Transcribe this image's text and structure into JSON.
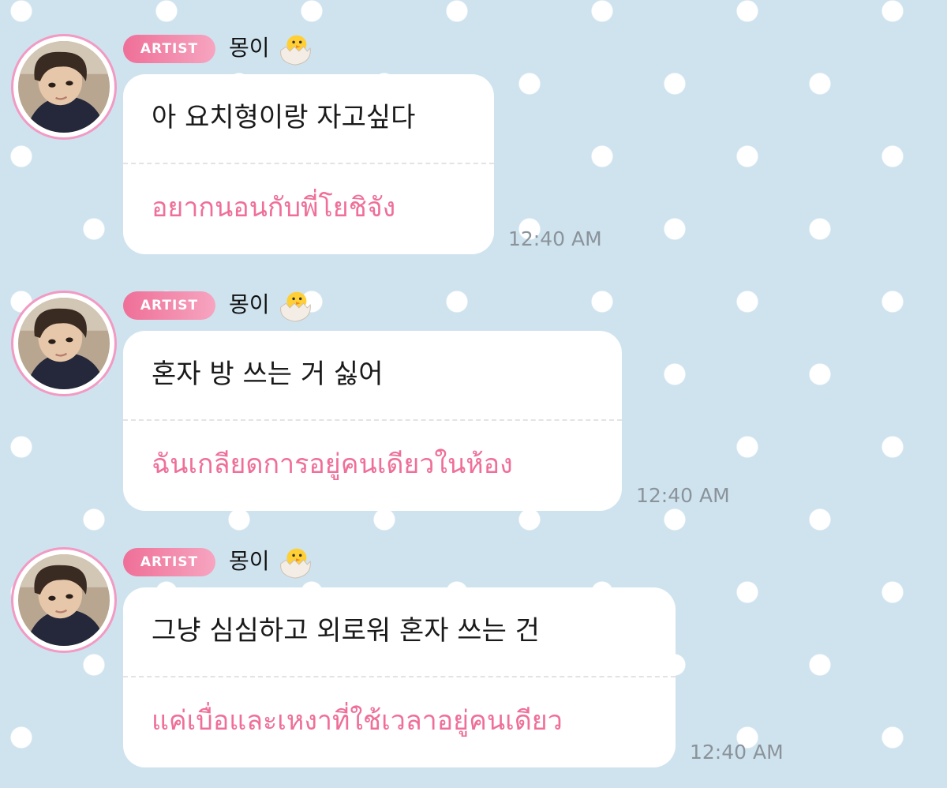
{
  "messages": [
    {
      "badge": "ARTIST",
      "sender": "몽이",
      "korean": "아 요치형이랑 자고싶다",
      "thai": "อยากนอนกับพี่โยชิจัง",
      "time": "12:40 AM"
    },
    {
      "badge": "ARTIST",
      "sender": "몽이",
      "korean": "혼자 방 쓰는 거 싫어",
      "thai": "ฉันเกลียดการอยู่คนเดียวในห้อง",
      "time": "12:40 AM"
    },
    {
      "badge": "ARTIST",
      "sender": "몽이",
      "korean": "그냥 심심하고 외로워 혼자 쓰는 건",
      "thai": "แค่เบื่อและเหงาที่ใช้เวลาอยู่คนเดียว",
      "time": "12:40 AM"
    }
  ],
  "icons": {
    "sender_emoji": "hatching-chick-icon",
    "avatar": "avatar-photo"
  },
  "colors": {
    "background": "#cfe3ef",
    "badge_start": "#ef6f98",
    "badge_end": "#f6a5c0",
    "translation_text": "#ef6f98",
    "avatar_ring": "#f29ac3",
    "timestamp": "#8b939a"
  }
}
